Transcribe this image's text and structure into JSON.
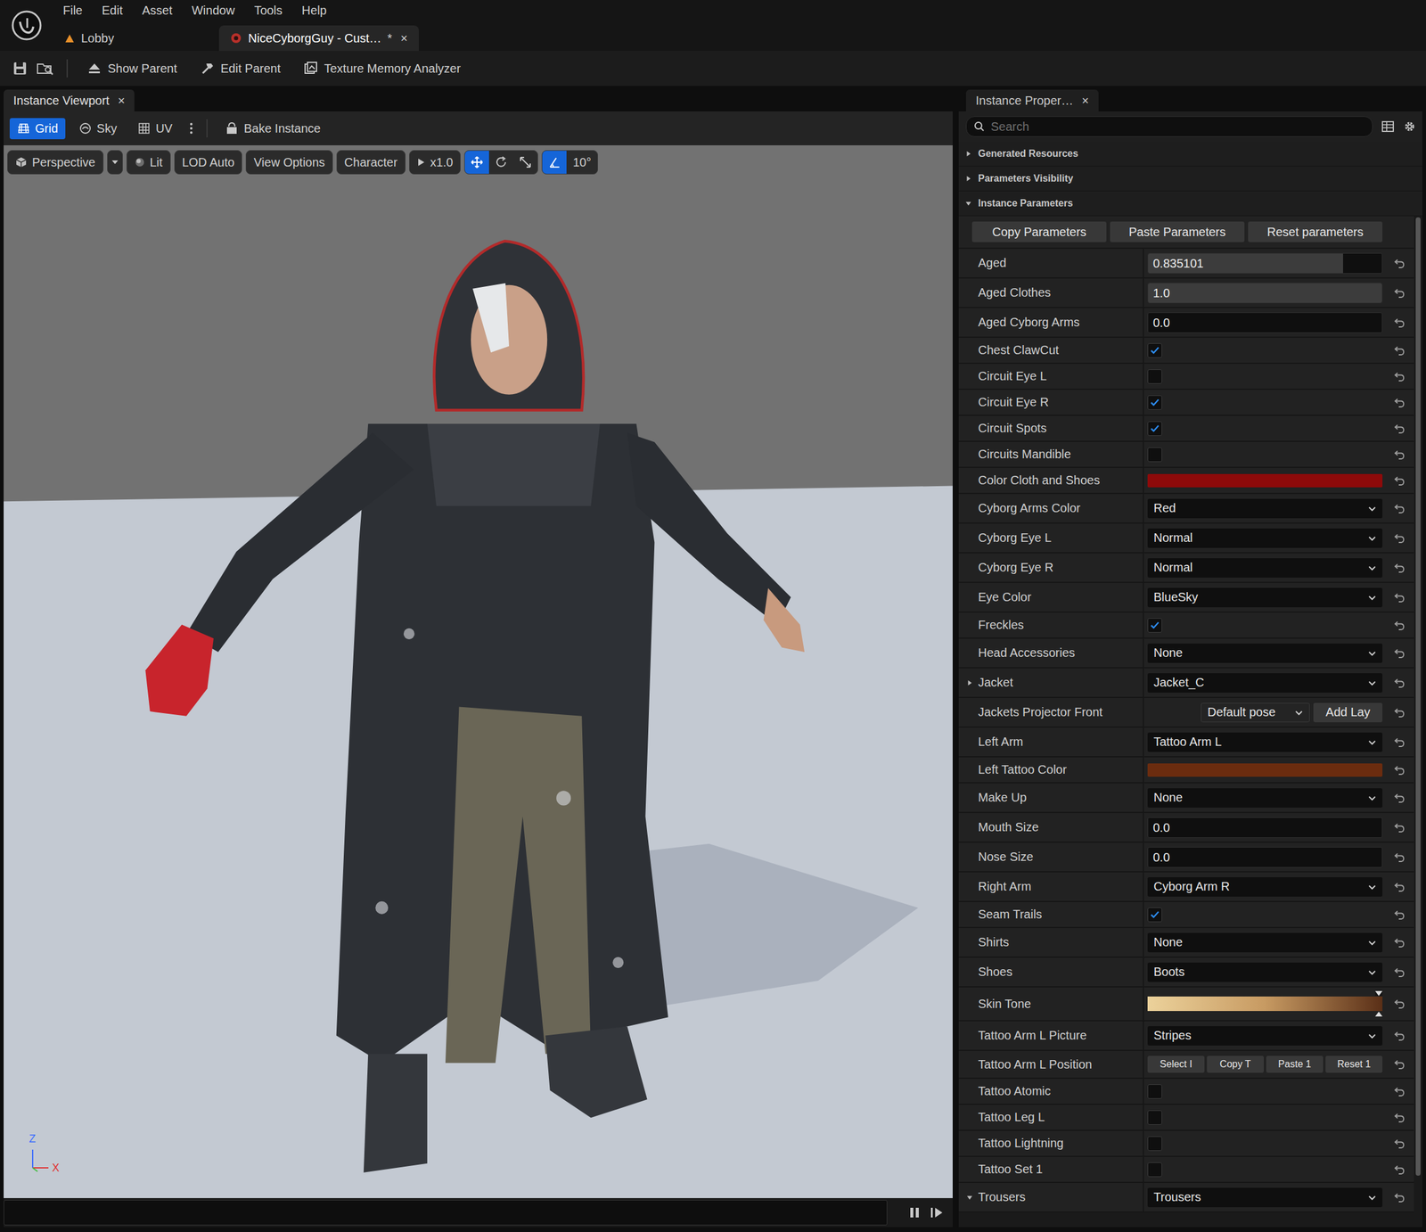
{
  "menu": [
    "File",
    "Edit",
    "Asset",
    "Window",
    "Tools",
    "Help"
  ],
  "tabs": [
    {
      "label": "Lobby",
      "selected": false
    },
    {
      "label": "NiceCyborgGuy - Cust…",
      "selected": true,
      "dirty": "*",
      "close": "×"
    }
  ],
  "toolbar": [
    {
      "label": "Show Parent"
    },
    {
      "label": "Edit Parent"
    },
    {
      "label": "Texture Memory Analyzer"
    }
  ],
  "viewport_panel": {
    "tab": "Instance Viewport",
    "close": "×",
    "tools": [
      {
        "label": "Grid",
        "selected": true
      },
      {
        "label": "Sky",
        "selected": false
      },
      {
        "label": "UV",
        "selected": false
      }
    ],
    "bake": "Bake Instance"
  },
  "viewport": {
    "view_mode": "Perspective",
    "options": [
      "Lit",
      "LOD Auto",
      "View Options",
      "Character"
    ],
    "speed": "x1.0",
    "transform": [
      {
        "tool": "translate",
        "selected": true
      },
      {
        "tool": "rotate",
        "selected": false
      },
      {
        "tool": "scale",
        "selected": false
      }
    ],
    "snap": {
      "on": true,
      "value": "10°"
    },
    "axes": [
      {
        "label": "Z",
        "color": "#3b6cff"
      },
      {
        "label": "X",
        "color": "#e03030"
      }
    ]
  },
  "properties_panel": {
    "tab": "Instance Proper…",
    "close": "×",
    "search": {
      "placeholder": "Search"
    },
    "sections": [
      {
        "label": "Generated Resources",
        "expanded": false
      },
      {
        "label": "Parameters Visibility",
        "expanded": false
      },
      {
        "label": "Instance Parameters",
        "expanded": true
      }
    ],
    "actions": [
      "Copy Parameters",
      "Paste Parameters",
      "Reset parameters"
    ],
    "params": [
      {
        "label": "Aged",
        "kind": "number",
        "value": "0.835101",
        "level": 0.835
      },
      {
        "label": "Aged Clothes",
        "kind": "number",
        "value": "1.0",
        "level": 1
      },
      {
        "label": "Aged Cyborg Arms",
        "kind": "number",
        "value": "0.0",
        "level": 0
      },
      {
        "label": "Chest ClawCut",
        "kind": "checkbox",
        "checked": true
      },
      {
        "label": "Circuit Eye L",
        "kind": "checkbox",
        "checked": false
      },
      {
        "label": "Circuit Eye R",
        "kind": "checkbox",
        "checked": true
      },
      {
        "label": "Circuit Spots",
        "kind": "checkbox",
        "checked": true
      },
      {
        "label": "Circuits Mandible",
        "kind": "checkbox",
        "checked": false
      },
      {
        "label": "Color Cloth and Shoes",
        "kind": "color",
        "color": "#8e0a0a"
      },
      {
        "label": "Cyborg Arms Color",
        "kind": "combo",
        "value": "Red"
      },
      {
        "label": "Cyborg Eye L",
        "kind": "combo",
        "value": "Normal"
      },
      {
        "label": "Cyborg Eye R",
        "kind": "combo",
        "value": "Normal"
      },
      {
        "label": "Eye Color",
        "kind": "combo",
        "value": "BlueSky"
      },
      {
        "label": "Freckles",
        "kind": "checkbox",
        "checked": true
      },
      {
        "label": "Head Accessories",
        "kind": "combo",
        "value": "None"
      },
      {
        "label": "Jacket",
        "kind": "combo",
        "value": "Jacket_C",
        "expanded": false
      },
      {
        "label": "Jackets Projector Front",
        "kind": "projector",
        "value": "Default pose",
        "button": "Add Lay"
      },
      {
        "label": "Left Arm",
        "kind": "combo",
        "value": "Tattoo Arm L"
      },
      {
        "label": "Left Tattoo Color",
        "kind": "color",
        "color": "#6b2c0f"
      },
      {
        "label": "Make Up",
        "kind": "combo",
        "value": "None"
      },
      {
        "label": "Mouth Size",
        "kind": "number",
        "value": "0.0",
        "level": 0
      },
      {
        "label": "Nose Size",
        "kind": "number",
        "value": "0.0",
        "level": 0
      },
      {
        "label": "Right Arm",
        "kind": "combo",
        "value": "Cyborg Arm R"
      },
      {
        "label": "Seam Trails",
        "kind": "checkbox",
        "checked": true
      },
      {
        "label": "Shirts",
        "kind": "combo",
        "value": "None"
      },
      {
        "label": "Shoes",
        "kind": "combo",
        "value": "Boots"
      },
      {
        "label": "Skin Tone",
        "kind": "gradient",
        "colors": [
          "#ecd29b",
          "#c79a62",
          "#5a2f17"
        ],
        "level": 0.985
      },
      {
        "label": "Tattoo Arm L Picture",
        "kind": "combo",
        "value": "Stripes"
      },
      {
        "label": "Tattoo Arm L Position",
        "kind": "buttons",
        "buttons": [
          "Select I",
          "Copy T",
          "Paste 1",
          "Reset 1"
        ]
      },
      {
        "label": "Tattoo Atomic",
        "kind": "checkbox",
        "checked": false
      },
      {
        "label": "Tattoo Leg L",
        "kind": "checkbox",
        "checked": false
      },
      {
        "label": "Tattoo Lightning",
        "kind": "checkbox",
        "checked": false
      },
      {
        "label": "Tattoo Set 1",
        "kind": "checkbox",
        "checked": false
      },
      {
        "label": "Trousers",
        "kind": "combo",
        "value": "Trousers",
        "expanded": true
      }
    ],
    "scrollbar": {
      "level": 0.95
    }
  }
}
